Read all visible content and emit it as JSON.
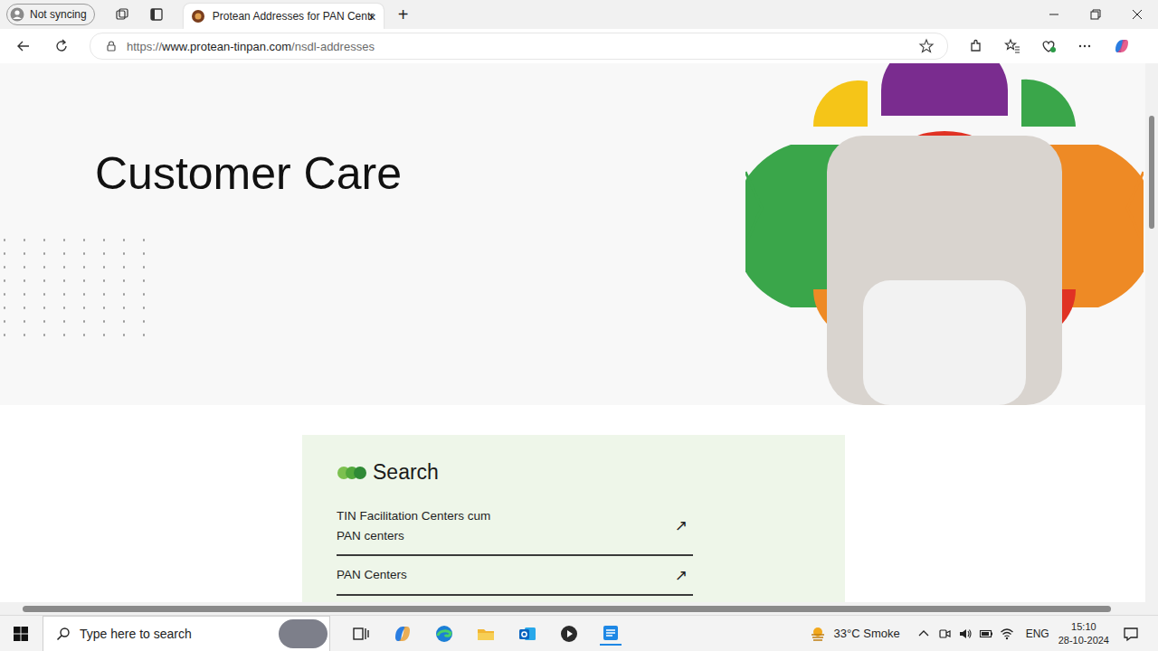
{
  "browser": {
    "profile": "Not syncing",
    "tabs": [
      {
        "label": "Protean Addresses for PAN Centr",
        "selected": true,
        "close": "×"
      }
    ],
    "new_tab": "+",
    "address": "https://www.protean-tinpan.com/nsdl-addresses"
  },
  "page": {
    "heading": "Customer Care",
    "search": {
      "title": "Search",
      "items": [
        {
          "label": "TIN Facilitation Centers cum PAN centers",
          "arrow": "↗"
        },
        {
          "label": "PAN Centers",
          "arrow": "↗"
        }
      ]
    }
  },
  "taskbar": {
    "search_placeholder": "Type here to search",
    "weather": "33°C Smoke",
    "language": "ENG",
    "time": "15:10",
    "date": "28-10-2024"
  }
}
